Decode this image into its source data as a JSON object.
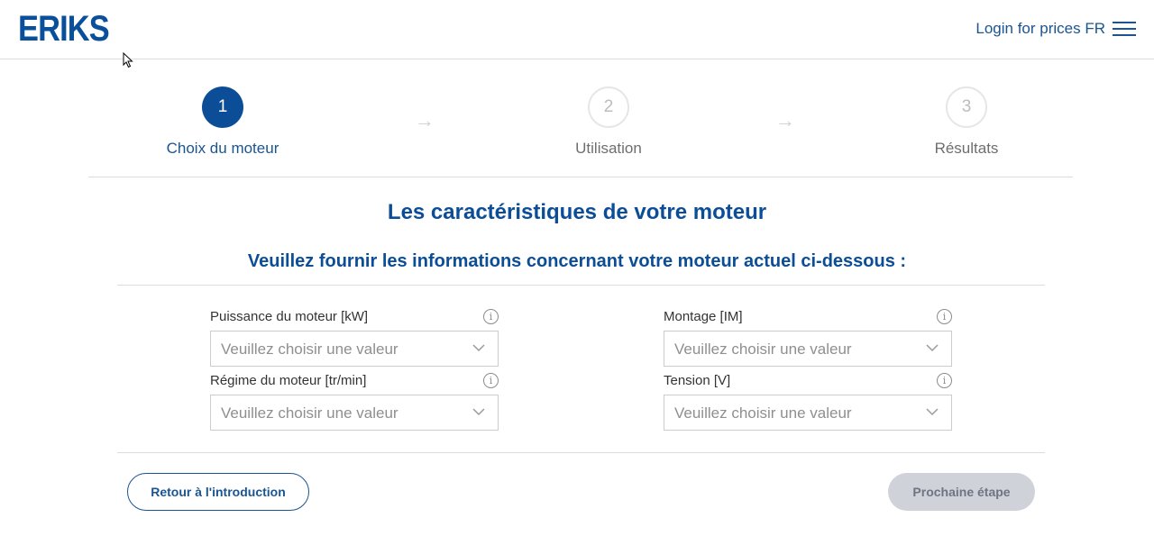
{
  "header": {
    "logo": "ERIKS",
    "login_text": "Login for prices FR",
    "menu_icon": "hamburger-menu-icon"
  },
  "stepper": {
    "steps": [
      {
        "number": "1",
        "label": "Choix du moteur",
        "state": "active"
      },
      {
        "number": "2",
        "label": "Utilisation",
        "state": "inactive"
      },
      {
        "number": "3",
        "label": "Résultats",
        "state": "inactive"
      }
    ],
    "arrow": "→"
  },
  "main": {
    "title": "Les caractéristiques de votre moteur",
    "subtitle": "Veuillez fournir les informations concernant votre moteur actuel ci-dessous :"
  },
  "form": {
    "fields": [
      {
        "label": "Puissance du moteur [kW]",
        "placeholder": "Veuillez choisir une valeur"
      },
      {
        "label": "Montage [IM]",
        "placeholder": "Veuillez choisir une valeur"
      },
      {
        "label": "Régime du moteur [tr/min]",
        "placeholder": "Veuillez choisir une valeur"
      },
      {
        "label": "Tension [V]",
        "placeholder": "Veuillez choisir une valeur"
      }
    ],
    "info_glyph": "i"
  },
  "actions": {
    "back_label": "Retour à l'introduction",
    "next_label": "Prochaine étape"
  },
  "colors": {
    "brand": "#0b4e97",
    "disabled_button": "#cfd2d9"
  }
}
